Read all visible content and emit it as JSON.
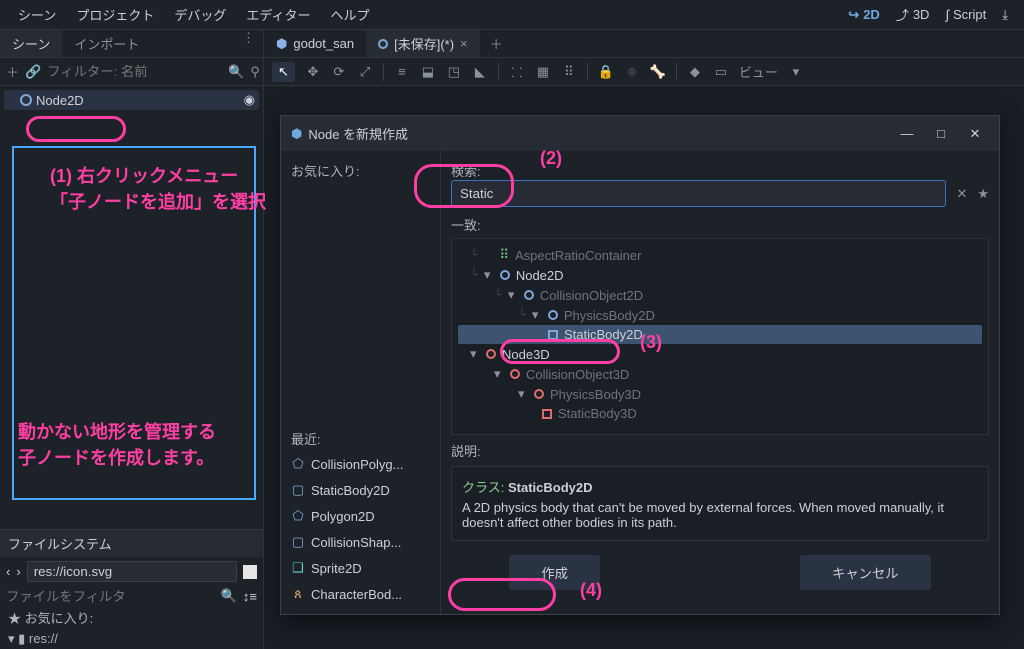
{
  "menubar": {
    "items": [
      "シーン",
      "プロジェクト",
      "デバッグ",
      "エディター",
      "ヘルプ"
    ],
    "right": {
      "d2": "2D",
      "d3": "3D",
      "script": "Script"
    }
  },
  "scene_dock": {
    "tabs": {
      "scene": "シーン",
      "import": "インポート"
    },
    "filter_placeholder": "フィルター: 名前",
    "root_node": "Node2D"
  },
  "filesystem": {
    "title": "ファイルシステム",
    "path": "res://icon.svg",
    "filter_placeholder": "ファイルをフィルタ",
    "favorites": "お気に入り:",
    "res": "res://"
  },
  "scene_tabs": {
    "tab1": "godot_san",
    "tab2": "[未保存](*)"
  },
  "viewport_toolbar": {
    "view_label": "ビュー"
  },
  "modal": {
    "title": "Node を新規作成",
    "favorites_label": "お気に入り:",
    "recent_label": "最近:",
    "search_label": "検索:",
    "search_value": "Static",
    "match_label": "一致:",
    "desc_label": "説明:",
    "class_prefix": "クラス: ",
    "class_name": "StaticBody2D",
    "class_desc": "A 2D physics body that can't be moved by external forces. When moved manually, it doesn't affect other bodies in its path.",
    "create_btn": "作成",
    "cancel_btn": "キャンセル",
    "recent_items": [
      {
        "icon": "poly",
        "color": "c-blue",
        "label": "CollisionPolyg..."
      },
      {
        "icon": "sq",
        "color": "c-blue",
        "label": "StaticBody2D"
      },
      {
        "icon": "poly",
        "color": "c-blue",
        "label": "Polygon2D"
      },
      {
        "icon": "sq",
        "color": "c-blue",
        "label": "CollisionShap..."
      },
      {
        "icon": "spr",
        "color": "c-cyan",
        "label": "Sprite2D"
      },
      {
        "icon": "char",
        "color": "c-orange",
        "label": "CharacterBod..."
      }
    ],
    "tree": {
      "aspect": "AspectRatioContainer",
      "node2d": "Node2D",
      "collobj2d": "CollisionObject2D",
      "physbody2d": "PhysicsBody2D",
      "staticbody2d": "StaticBody2D",
      "node3d": "Node3D",
      "collobj3d": "CollisionObject3D",
      "physbody3d": "PhysicsBody3D",
      "staticbody3d": "StaticBody3D"
    }
  },
  "annotations": {
    "a1": "(1) 右クリックメニュー\n「子ノードを追加」を選択",
    "a2": "動かない地形を管理する\n子ノードを作成します。",
    "n2": "(2)",
    "n3": "(3)",
    "n4": "(4)"
  }
}
